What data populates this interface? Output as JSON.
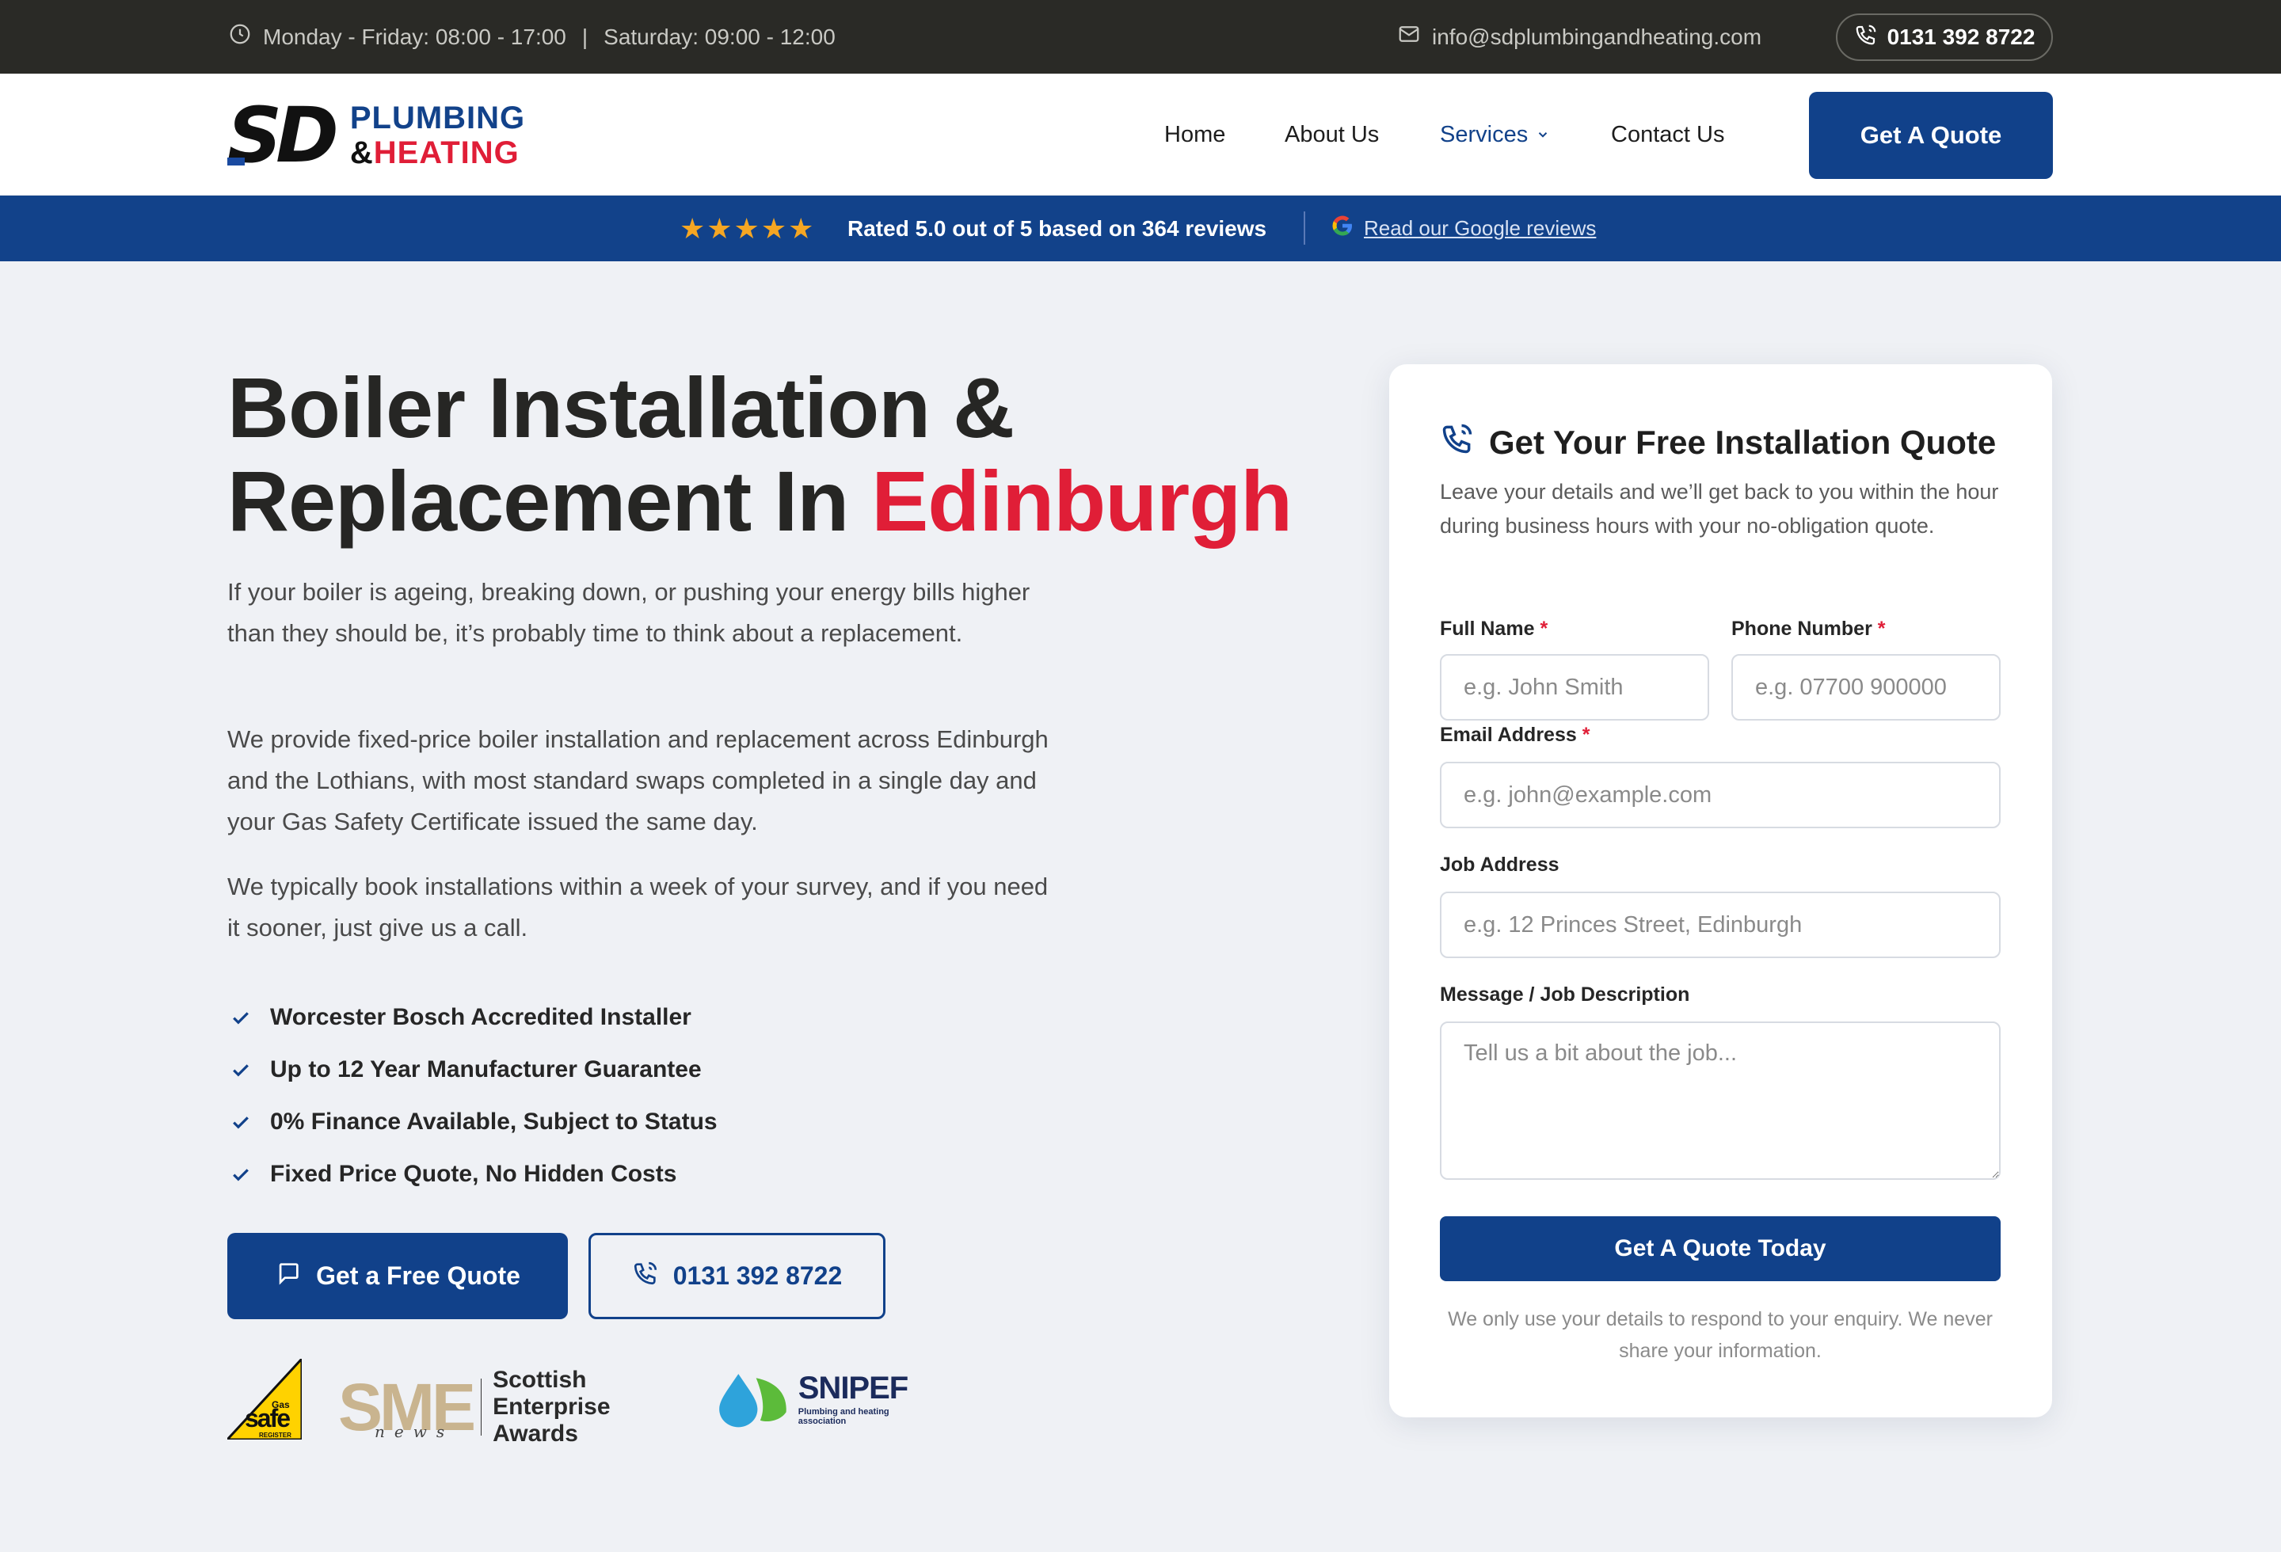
{
  "topbar": {
    "hours_weekday": "Monday - Friday: 08:00 - 17:00",
    "separator": "|",
    "hours_saturday": "Saturday: 09:00 - 12:00",
    "email": "info@sdplumbingandheating.com",
    "phone": "0131 392 8722"
  },
  "header": {
    "logo_mark": "SD",
    "logo_line1": "PLUMBING",
    "logo_amp": "&",
    "logo_line2": "HEATING",
    "nav": {
      "home": "Home",
      "about": "About Us",
      "services": "Services",
      "contact": "Contact Us"
    },
    "quote_button": "Get A Quote"
  },
  "rating": {
    "stars": "★★★★★",
    "text": "Rated 5.0 out of 5 based on 364 reviews",
    "google_link": "Read our Google reviews"
  },
  "hero": {
    "title_line1": "Boiler Installation &",
    "title_line2_prefix": "Replacement In ",
    "title_highlight": "Edinburgh",
    "paragraphs": [
      "If your boiler is ageing, breaking down, or pushing your energy bills higher than they should be, it’s probably time to think about a replacement.",
      "We provide fixed-price boiler installation and replacement across Edinburgh and the Lothians, with most standard swaps completed in a single day and your Gas Safety Certificate issued the same day.",
      "We typically book installations within a week of your survey, and if you need it sooner, just give us a call."
    ],
    "checklist": [
      "Worcester Bosch Accredited Installer",
      "Up to 12 Year Manufacturer Guarantee",
      "0% Finance Available, Subject to Status",
      "Fixed Price Quote, No Hidden Costs"
    ],
    "cta_primary": "Get a Free Quote",
    "cta_phone": "0131 392 8722"
  },
  "badges": {
    "gas_safe_small": "Gas",
    "gas_safe_big": "safe",
    "gas_safe_register": "REGISTER",
    "sme_letters": "SME",
    "sme_news": "news",
    "sme_awards_line1": "Scottish Enterprise",
    "sme_awards_line2": "Awards",
    "snipef_name": "SNIPEF",
    "snipef_tagline": "Plumbing and heating association"
  },
  "form": {
    "title": "Get Your Free Installation Quote",
    "subtitle": "Leave your details and we’ll get back to you within the hour during business hours with your no-obligation quote.",
    "required_mark": "*",
    "full_name_label": "Full Name",
    "full_name_placeholder": "e.g. John Smith",
    "phone_label": "Phone Number",
    "phone_placeholder": "e.g. 07700 900000",
    "email_label": "Email Address",
    "email_placeholder": "e.g. john@example.com",
    "address_label": "Job Address",
    "address_placeholder": "e.g. 12 Princes Street, Edinburgh",
    "message_label": "Message / Job Description",
    "message_placeholder": "Tell us a bit about the job...",
    "submit": "Get A Quote Today",
    "privacy": "We only use your details to respond to your enquiry. We never share your information."
  },
  "colors": {
    "brand_blue": "#11418a",
    "accent_red": "#e01e37",
    "topbar_bg": "#2a2a26",
    "star_gold": "#f5a623"
  },
  "icons": [
    "clock-icon",
    "mail-icon",
    "phone-icon",
    "chevron-down-icon",
    "star-icon",
    "google-icon",
    "check-icon",
    "chat-icon"
  ]
}
